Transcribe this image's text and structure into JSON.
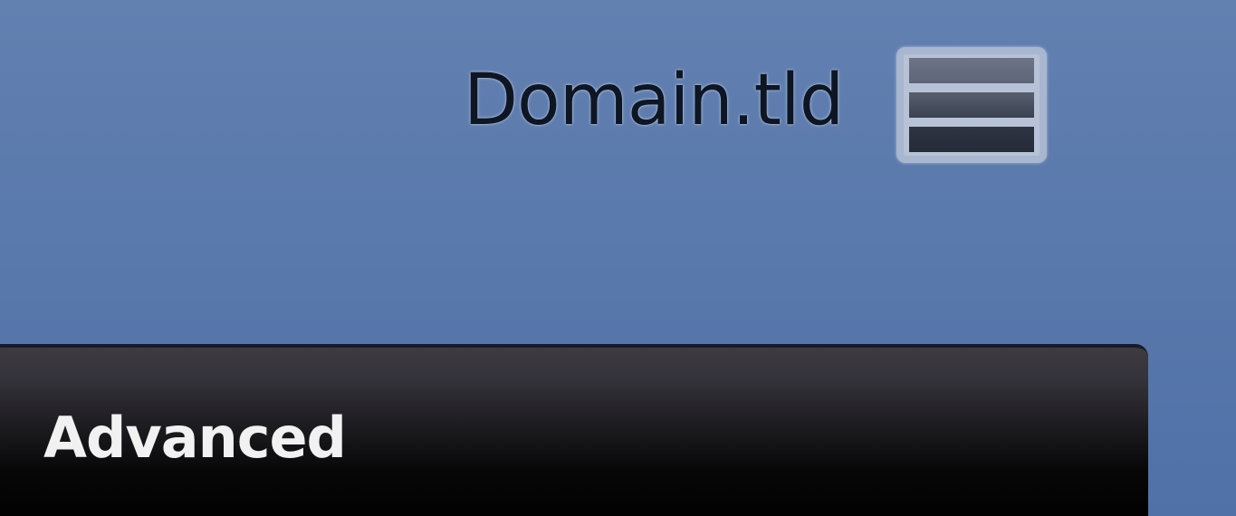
{
  "header": {
    "domain_label": "Domain.tld",
    "menu_button_icon": "hamburger-menu-icon"
  },
  "tab_bar": {
    "active_tab_label": "Advanced"
  },
  "colors": {
    "background": "#5a79ac",
    "domain_text": "#0e1624",
    "tab_bar_top": "#3e3b40",
    "tab_bar_bottom": "#000000",
    "tab_text": "#f1f1f1"
  }
}
